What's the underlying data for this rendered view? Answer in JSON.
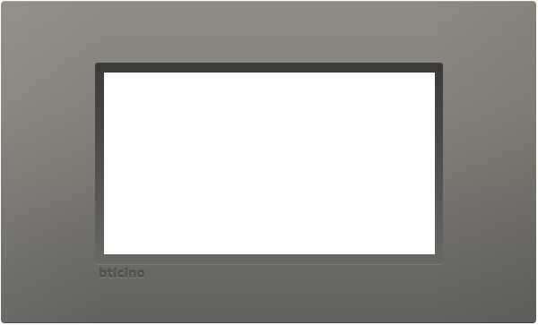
{
  "product": {
    "brand_logo_text": "bticino",
    "plate_color": "#7d7a74",
    "opening_color": "#ffffff"
  }
}
